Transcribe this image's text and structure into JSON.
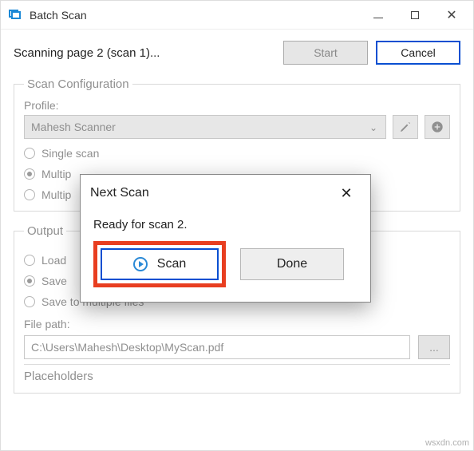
{
  "window": {
    "title": "Batch Scan"
  },
  "status": {
    "text": "Scanning page 2 (scan 1)...",
    "start_label": "Start",
    "cancel_label": "Cancel"
  },
  "config_group": {
    "legend": "Scan Configuration",
    "profile_label": "Profile:",
    "profile_value": "Mahesh Scanner",
    "radio_single": "Single scan",
    "radio_multi1": "Multip",
    "radio_multi2": "Multip"
  },
  "output_group": {
    "legend": "Output",
    "radio_load": "Load",
    "radio_save_single_partial": "Save",
    "radio_save_multiple": "Save to multiple files",
    "filepath_label": "File path:",
    "filepath_value": "C:\\Users\\Mahesh\\Desktop\\MyScan.pdf",
    "browse_label": "...",
    "placeholders_label": "Placeholders"
  },
  "modal": {
    "title": "Next Scan",
    "message": "Ready for scan 2.",
    "scan_label": "Scan",
    "done_label": "Done"
  },
  "watermark": "wsxdn.com"
}
